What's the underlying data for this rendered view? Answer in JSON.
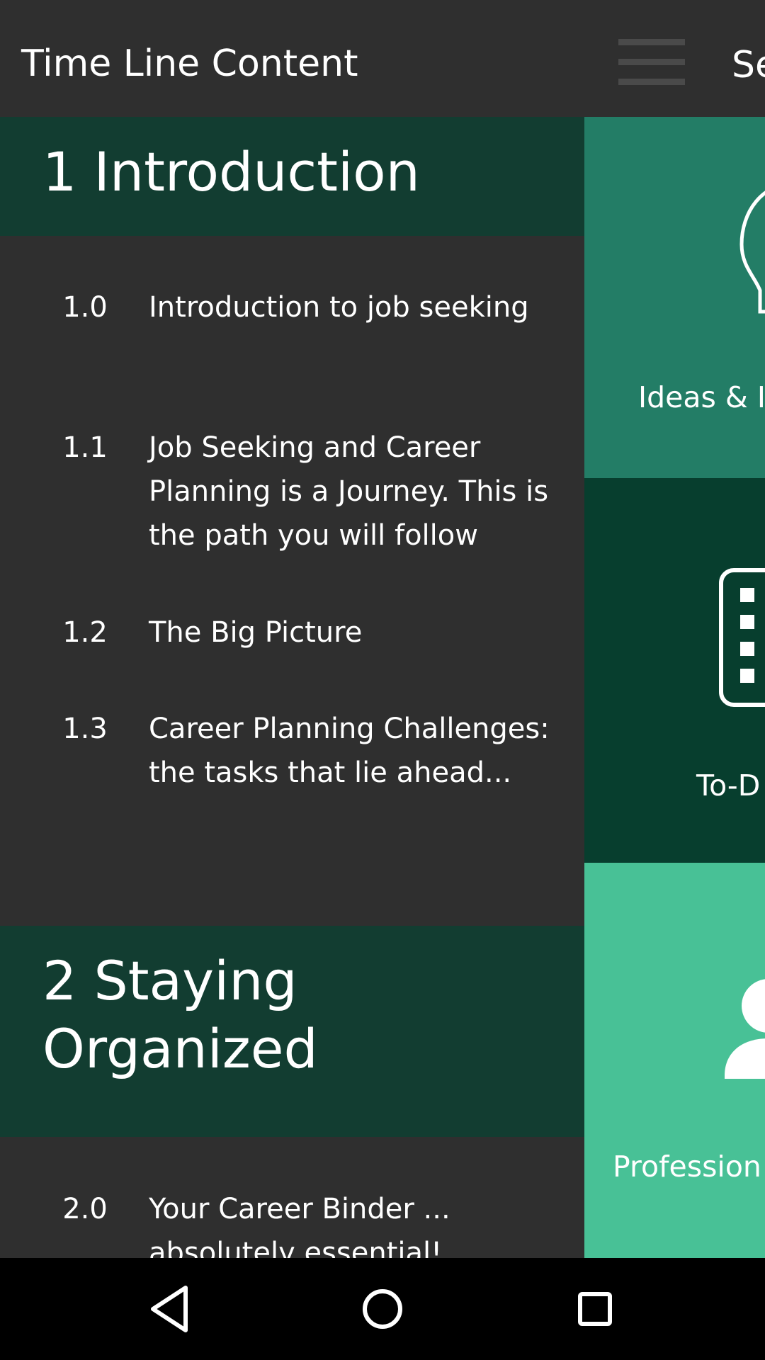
{
  "background": {
    "title": "Se",
    "tiles": [
      {
        "label": "Ideas & I",
        "icon": "lightbulb-icon",
        "color": "#237d66"
      },
      {
        "label": "To-D",
        "icon": "checklist-icon",
        "color": "#073e2e"
      },
      {
        "label": "Profession",
        "icon": "person-icon",
        "color": "#48c196"
      }
    ]
  },
  "drawer": {
    "title": "Time Line Content",
    "sections": [
      {
        "heading": "1 Introduction",
        "items": [
          {
            "num": "1.0",
            "text": "Introduction to job seeking"
          },
          {
            "num": "1.1",
            "text": "Job Seeking and Career Planning is a Journey. This is the path you will follow"
          },
          {
            "num": "1.2",
            "text": "The Big Picture"
          },
          {
            "num": "1.3",
            "text": "Career Planning Challenges: the tasks that lie ahead..."
          }
        ]
      },
      {
        "heading": "2 Staying Organized",
        "items": [
          {
            "num": "2.0",
            "text": "Your Career Binder ... absolutely essential!"
          }
        ]
      }
    ]
  },
  "nav": {
    "back_icon": "back-triangle-icon",
    "home_icon": "home-circle-icon",
    "recents_icon": "recents-square-icon"
  },
  "colors": {
    "section_header": "#123d31",
    "drawer_bg": "#2f2f2f"
  }
}
